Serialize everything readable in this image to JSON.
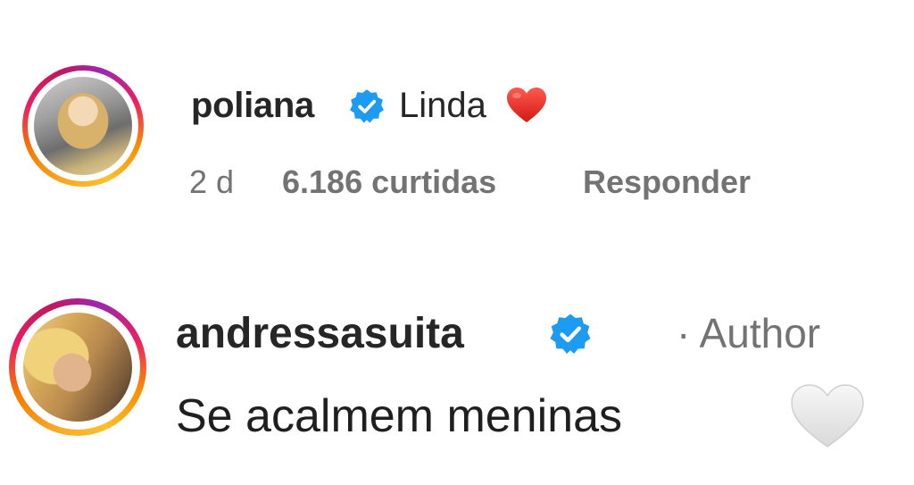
{
  "comments": [
    {
      "username": "poliana",
      "verified": true,
      "text": "Linda",
      "emoji": "red-heart",
      "time": "2 d",
      "likes": "6.186 curtidas",
      "reply_label": "Responder",
      "avatar": "profile-photo"
    },
    {
      "username": "andressasuita",
      "verified": true,
      "author_tag": "· Author",
      "text": "Se acalmem meninas",
      "emoji": "white-heart",
      "avatar": "profile-photo"
    }
  ],
  "colors": {
    "primary_text": "#262626",
    "secondary_text": "#737373",
    "verified_blue": "#1d9bf0",
    "heart_red": "#e0241c"
  },
  "icons": [
    "verified-badge-icon",
    "red-heart-icon",
    "white-heart-icon"
  ]
}
